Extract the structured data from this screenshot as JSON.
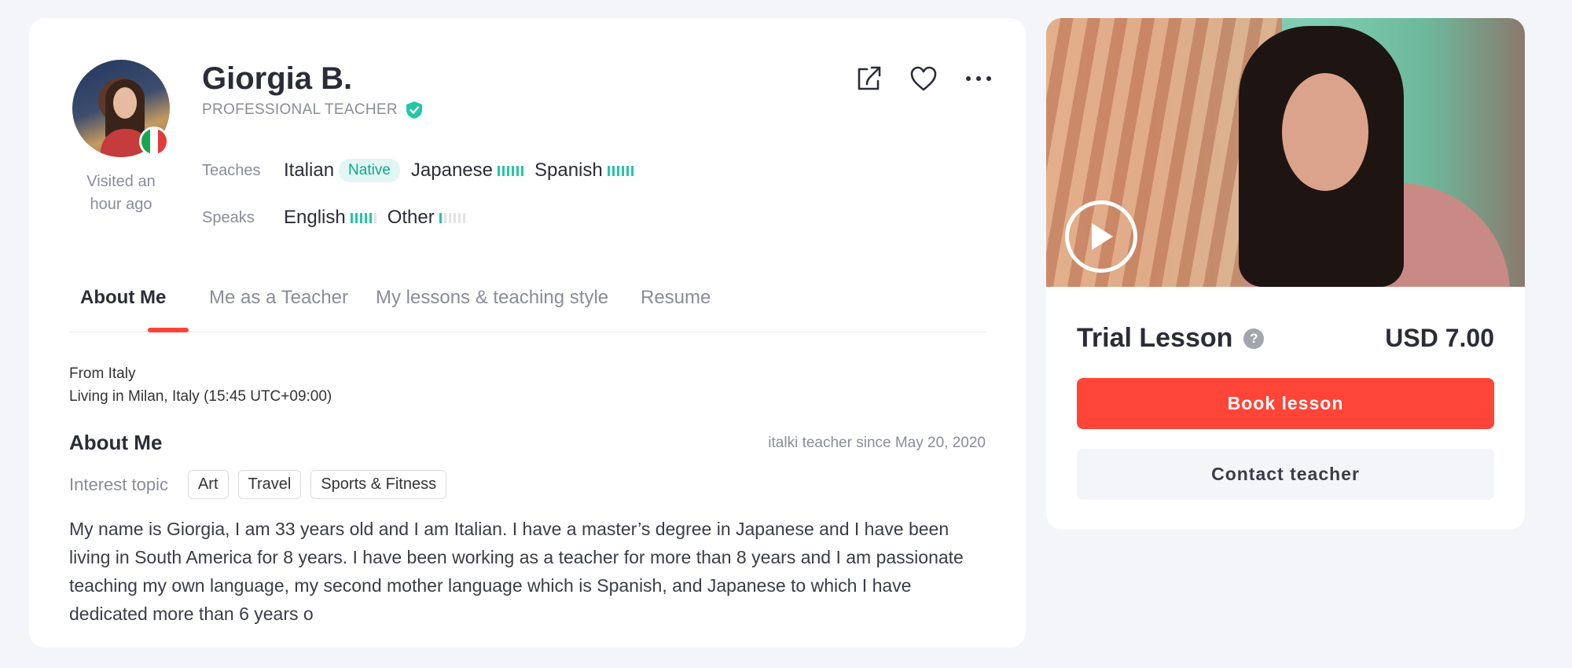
{
  "teacher": {
    "name": "Giorgia B.",
    "role": "PROFESSIONAL TEACHER",
    "visited": "Visited an hour ago",
    "teaches_label": "Teaches",
    "speaks_label": "Speaks",
    "teaches": [
      {
        "name": "Italian",
        "badge": "Native"
      },
      {
        "name": "Japanese",
        "level": 6
      },
      {
        "name": "Spanish",
        "level": 6
      }
    ],
    "speaks": [
      {
        "name": "English",
        "level": 5
      },
      {
        "name": "Other",
        "level": 1
      }
    ],
    "level_max": 6
  },
  "tabs": [
    {
      "label": "About Me",
      "active": true
    },
    {
      "label": "Me as a Teacher",
      "active": false
    },
    {
      "label": "My lessons & teaching style",
      "active": false
    },
    {
      "label": "Resume",
      "active": false
    }
  ],
  "about": {
    "from": "From Italy",
    "living": "Living in Milan, Italy (15:45 UTC+09:00)",
    "heading": "About Me",
    "since": "italki teacher since May 20, 2020",
    "interest_label": "Interest topic",
    "interests": [
      "Art",
      "Travel",
      "Sports & Fitness"
    ],
    "bio": "My name is Giorgia, I am 33 years old and I am Italian. I have a master’s degree in Japanese and I have been living in South America for 8 years. I have been working as a teacher for more than 8 years and I am passionate teaching my own language, my second mother language which is Spanish, and Japanese to which I have dedicated more than 6 years o"
  },
  "booking": {
    "trial_title": "Trial Lesson",
    "help": "?",
    "price": "USD 7.00",
    "book_label": "Book lesson",
    "contact_label": "Contact teacher"
  },
  "icons": {
    "share": "share-icon",
    "favorite": "heart-icon",
    "more": "more-icon",
    "verified": "shield-check-icon",
    "play": "play-icon"
  },
  "colors": {
    "accent": "#ff4438",
    "level": "#24c7a4",
    "native_bg": "#e2f6f3",
    "native_text": "#12a68c",
    "verified": "#24c7a4"
  }
}
